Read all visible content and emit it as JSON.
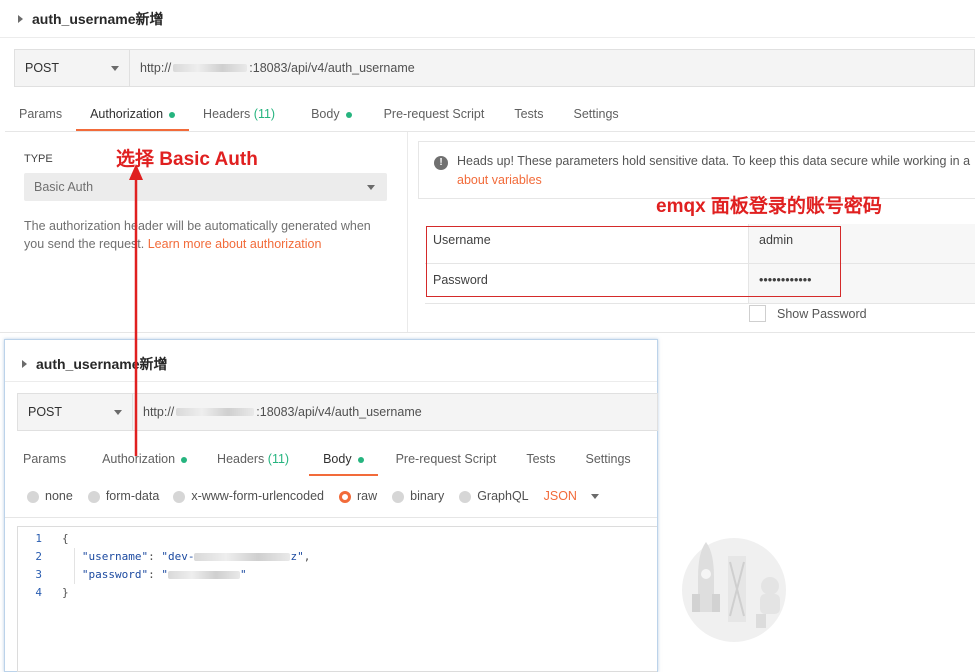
{
  "top": {
    "request_title": "auth_username新增",
    "method": "POST",
    "url_prefix": "http://",
    "url_suffix": ":18083/api/v4/auth_username",
    "tabs": [
      {
        "label": "Params"
      },
      {
        "label": "Authorization"
      },
      {
        "label": "Headers",
        "count": "(11)"
      },
      {
        "label": "Body"
      },
      {
        "label": "Pre-request Script"
      },
      {
        "label": "Tests"
      },
      {
        "label": "Settings"
      }
    ],
    "type_label": "TYPE",
    "type_value": "Basic Auth",
    "auth_help": "The authorization header will be automatically generated when you send the request.",
    "auth_link": "Learn more about authorization",
    "notice": "Heads up! These parameters hold sensitive data. To keep this data secure while working in a",
    "notice_link": "about variables",
    "fields": [
      {
        "label": "Username",
        "value": "admin"
      },
      {
        "label": "Password",
        "value": "••••••••••••"
      }
    ],
    "show_password": "Show Password"
  },
  "annotations": {
    "choose_basic": "选择 Basic Auth",
    "emqx_note": "emqx 面板登录的账号密码"
  },
  "bottom": {
    "request_title": "auth_username新增",
    "method": "POST",
    "url_prefix": "http://",
    "url_suffix": ":18083/api/v4/auth_username",
    "tabs": [
      {
        "label": "Params"
      },
      {
        "label": "Authorization"
      },
      {
        "label": "Headers",
        "count": "(11)"
      },
      {
        "label": "Body"
      },
      {
        "label": "Pre-request Script"
      },
      {
        "label": "Tests"
      },
      {
        "label": "Settings"
      }
    ],
    "body_types": [
      "none",
      "form-data",
      "x-www-form-urlencoded",
      "raw",
      "binary",
      "GraphQL"
    ],
    "selected_type": "raw",
    "format": "JSON",
    "code": {
      "line_numbers": [
        "1",
        "2",
        "3",
        "4"
      ],
      "open": "{",
      "key1": "\"username\"",
      "val1_start": "\"dev-",
      "val1_end": "z\"",
      "key2": "\"password\"",
      "val2_start": "\"",
      "val2_end": "\"",
      "close": "}"
    }
  },
  "colors": {
    "accent": "#f26b3a",
    "annotation": "#e02020",
    "enabled_dot": "#26b47f"
  }
}
